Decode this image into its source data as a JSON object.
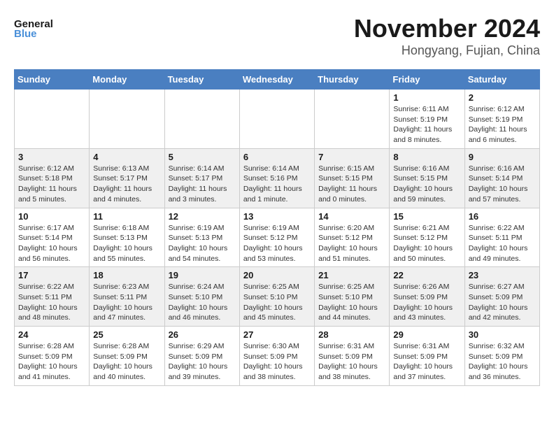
{
  "header": {
    "logo_line1": "General",
    "logo_line2": "Blue",
    "month_year": "November 2024",
    "location": "Hongyang, Fujian, China"
  },
  "calendar": {
    "days_of_week": [
      "Sunday",
      "Monday",
      "Tuesday",
      "Wednesday",
      "Thursday",
      "Friday",
      "Saturday"
    ],
    "weeks": [
      [
        {
          "day": "",
          "info": ""
        },
        {
          "day": "",
          "info": ""
        },
        {
          "day": "",
          "info": ""
        },
        {
          "day": "",
          "info": ""
        },
        {
          "day": "",
          "info": ""
        },
        {
          "day": "1",
          "info": "Sunrise: 6:11 AM\nSunset: 5:19 PM\nDaylight: 11 hours\nand 8 minutes."
        },
        {
          "day": "2",
          "info": "Sunrise: 6:12 AM\nSunset: 5:19 PM\nDaylight: 11 hours\nand 6 minutes."
        }
      ],
      [
        {
          "day": "3",
          "info": "Sunrise: 6:12 AM\nSunset: 5:18 PM\nDaylight: 11 hours\nand 5 minutes."
        },
        {
          "day": "4",
          "info": "Sunrise: 6:13 AM\nSunset: 5:17 PM\nDaylight: 11 hours\nand 4 minutes."
        },
        {
          "day": "5",
          "info": "Sunrise: 6:14 AM\nSunset: 5:17 PM\nDaylight: 11 hours\nand 3 minutes."
        },
        {
          "day": "6",
          "info": "Sunrise: 6:14 AM\nSunset: 5:16 PM\nDaylight: 11 hours\nand 1 minute."
        },
        {
          "day": "7",
          "info": "Sunrise: 6:15 AM\nSunset: 5:15 PM\nDaylight: 11 hours\nand 0 minutes."
        },
        {
          "day": "8",
          "info": "Sunrise: 6:16 AM\nSunset: 5:15 PM\nDaylight: 10 hours\nand 59 minutes."
        },
        {
          "day": "9",
          "info": "Sunrise: 6:16 AM\nSunset: 5:14 PM\nDaylight: 10 hours\nand 57 minutes."
        }
      ],
      [
        {
          "day": "10",
          "info": "Sunrise: 6:17 AM\nSunset: 5:14 PM\nDaylight: 10 hours\nand 56 minutes."
        },
        {
          "day": "11",
          "info": "Sunrise: 6:18 AM\nSunset: 5:13 PM\nDaylight: 10 hours\nand 55 minutes."
        },
        {
          "day": "12",
          "info": "Sunrise: 6:19 AM\nSunset: 5:13 PM\nDaylight: 10 hours\nand 54 minutes."
        },
        {
          "day": "13",
          "info": "Sunrise: 6:19 AM\nSunset: 5:12 PM\nDaylight: 10 hours\nand 53 minutes."
        },
        {
          "day": "14",
          "info": "Sunrise: 6:20 AM\nSunset: 5:12 PM\nDaylight: 10 hours\nand 51 minutes."
        },
        {
          "day": "15",
          "info": "Sunrise: 6:21 AM\nSunset: 5:12 PM\nDaylight: 10 hours\nand 50 minutes."
        },
        {
          "day": "16",
          "info": "Sunrise: 6:22 AM\nSunset: 5:11 PM\nDaylight: 10 hours\nand 49 minutes."
        }
      ],
      [
        {
          "day": "17",
          "info": "Sunrise: 6:22 AM\nSunset: 5:11 PM\nDaylight: 10 hours\nand 48 minutes."
        },
        {
          "day": "18",
          "info": "Sunrise: 6:23 AM\nSunset: 5:11 PM\nDaylight: 10 hours\nand 47 minutes."
        },
        {
          "day": "19",
          "info": "Sunrise: 6:24 AM\nSunset: 5:10 PM\nDaylight: 10 hours\nand 46 minutes."
        },
        {
          "day": "20",
          "info": "Sunrise: 6:25 AM\nSunset: 5:10 PM\nDaylight: 10 hours\nand 45 minutes."
        },
        {
          "day": "21",
          "info": "Sunrise: 6:25 AM\nSunset: 5:10 PM\nDaylight: 10 hours\nand 44 minutes."
        },
        {
          "day": "22",
          "info": "Sunrise: 6:26 AM\nSunset: 5:09 PM\nDaylight: 10 hours\nand 43 minutes."
        },
        {
          "day": "23",
          "info": "Sunrise: 6:27 AM\nSunset: 5:09 PM\nDaylight: 10 hours\nand 42 minutes."
        }
      ],
      [
        {
          "day": "24",
          "info": "Sunrise: 6:28 AM\nSunset: 5:09 PM\nDaylight: 10 hours\nand 41 minutes."
        },
        {
          "day": "25",
          "info": "Sunrise: 6:28 AM\nSunset: 5:09 PM\nDaylight: 10 hours\nand 40 minutes."
        },
        {
          "day": "26",
          "info": "Sunrise: 6:29 AM\nSunset: 5:09 PM\nDaylight: 10 hours\nand 39 minutes."
        },
        {
          "day": "27",
          "info": "Sunrise: 6:30 AM\nSunset: 5:09 PM\nDaylight: 10 hours\nand 38 minutes."
        },
        {
          "day": "28",
          "info": "Sunrise: 6:31 AM\nSunset: 5:09 PM\nDaylight: 10 hours\nand 38 minutes."
        },
        {
          "day": "29",
          "info": "Sunrise: 6:31 AM\nSunset: 5:09 PM\nDaylight: 10 hours\nand 37 minutes."
        },
        {
          "day": "30",
          "info": "Sunrise: 6:32 AM\nSunset: 5:09 PM\nDaylight: 10 hours\nand 36 minutes."
        }
      ]
    ]
  }
}
